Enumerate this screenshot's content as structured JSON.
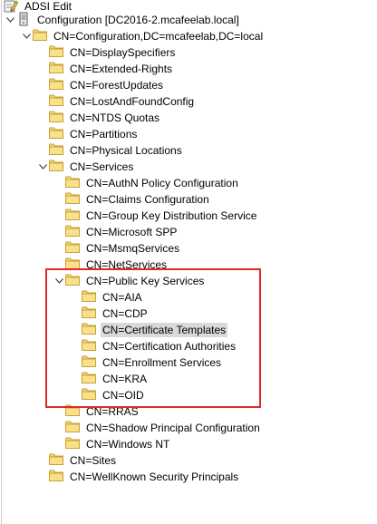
{
  "window": {
    "title": "ADSI Edit"
  },
  "highlight_color": "#e0282a",
  "tree": [
    {
      "label": "Configuration [DC2016-2.mcafeelab.local]",
      "depth": 0,
      "expand": "expanded",
      "icon": "server-icon"
    },
    {
      "label": "CN=Configuration,DC=mcafeelab,DC=local",
      "depth": 1,
      "expand": "expanded",
      "icon": "folder-icon"
    },
    {
      "label": "CN=DisplaySpecifiers",
      "depth": 2,
      "expand": "none",
      "icon": "folder-icon"
    },
    {
      "label": "CN=Extended-Rights",
      "depth": 2,
      "expand": "none",
      "icon": "folder-icon"
    },
    {
      "label": "CN=ForestUpdates",
      "depth": 2,
      "expand": "none",
      "icon": "folder-icon"
    },
    {
      "label": "CN=LostAndFoundConfig",
      "depth": 2,
      "expand": "none",
      "icon": "folder-icon"
    },
    {
      "label": "CN=NTDS Quotas",
      "depth": 2,
      "expand": "none",
      "icon": "folder-icon"
    },
    {
      "label": "CN=Partitions",
      "depth": 2,
      "expand": "none",
      "icon": "folder-icon"
    },
    {
      "label": "CN=Physical Locations",
      "depth": 2,
      "expand": "none",
      "icon": "folder-icon"
    },
    {
      "label": "CN=Services",
      "depth": 2,
      "expand": "expanded",
      "icon": "folder-icon"
    },
    {
      "label": "CN=AuthN Policy Configuration",
      "depth": 3,
      "expand": "none",
      "icon": "folder-icon"
    },
    {
      "label": "CN=Claims Configuration",
      "depth": 3,
      "expand": "none",
      "icon": "folder-icon"
    },
    {
      "label": "CN=Group Key Distribution Service",
      "depth": 3,
      "expand": "none",
      "icon": "folder-icon"
    },
    {
      "label": "CN=Microsoft SPP",
      "depth": 3,
      "expand": "none",
      "icon": "folder-icon"
    },
    {
      "label": "CN=MsmqServices",
      "depth": 3,
      "expand": "none",
      "icon": "folder-icon"
    },
    {
      "label": "CN=NetServices",
      "depth": 3,
      "expand": "none",
      "icon": "folder-icon"
    },
    {
      "label": "CN=Public Key Services",
      "depth": 3,
      "expand": "expanded",
      "icon": "folder-icon"
    },
    {
      "label": "CN=AIA",
      "depth": 4,
      "expand": "none",
      "icon": "folder-icon"
    },
    {
      "label": "CN=CDP",
      "depth": 4,
      "expand": "none",
      "icon": "folder-icon"
    },
    {
      "label": "CN=Certificate Templates",
      "depth": 4,
      "expand": "none",
      "icon": "folder-icon",
      "selected": true
    },
    {
      "label": "CN=Certification Authorities",
      "depth": 4,
      "expand": "none",
      "icon": "folder-icon"
    },
    {
      "label": "CN=Enrollment Services",
      "depth": 4,
      "expand": "none",
      "icon": "folder-icon"
    },
    {
      "label": "CN=KRA",
      "depth": 4,
      "expand": "none",
      "icon": "folder-icon"
    },
    {
      "label": "CN=OID",
      "depth": 4,
      "expand": "none",
      "icon": "folder-icon"
    },
    {
      "label": "CN=RRAS",
      "depth": 3,
      "expand": "none",
      "icon": "folder-icon"
    },
    {
      "label": "CN=Shadow Principal Configuration",
      "depth": 3,
      "expand": "none",
      "icon": "folder-icon"
    },
    {
      "label": "CN=Windows NT",
      "depth": 3,
      "expand": "none",
      "icon": "folder-icon"
    },
    {
      "label": "CN=Sites",
      "depth": 2,
      "expand": "none",
      "icon": "folder-icon"
    },
    {
      "label": "CN=WellKnown Security Principals",
      "depth": 2,
      "expand": "none",
      "icon": "folder-icon"
    }
  ]
}
